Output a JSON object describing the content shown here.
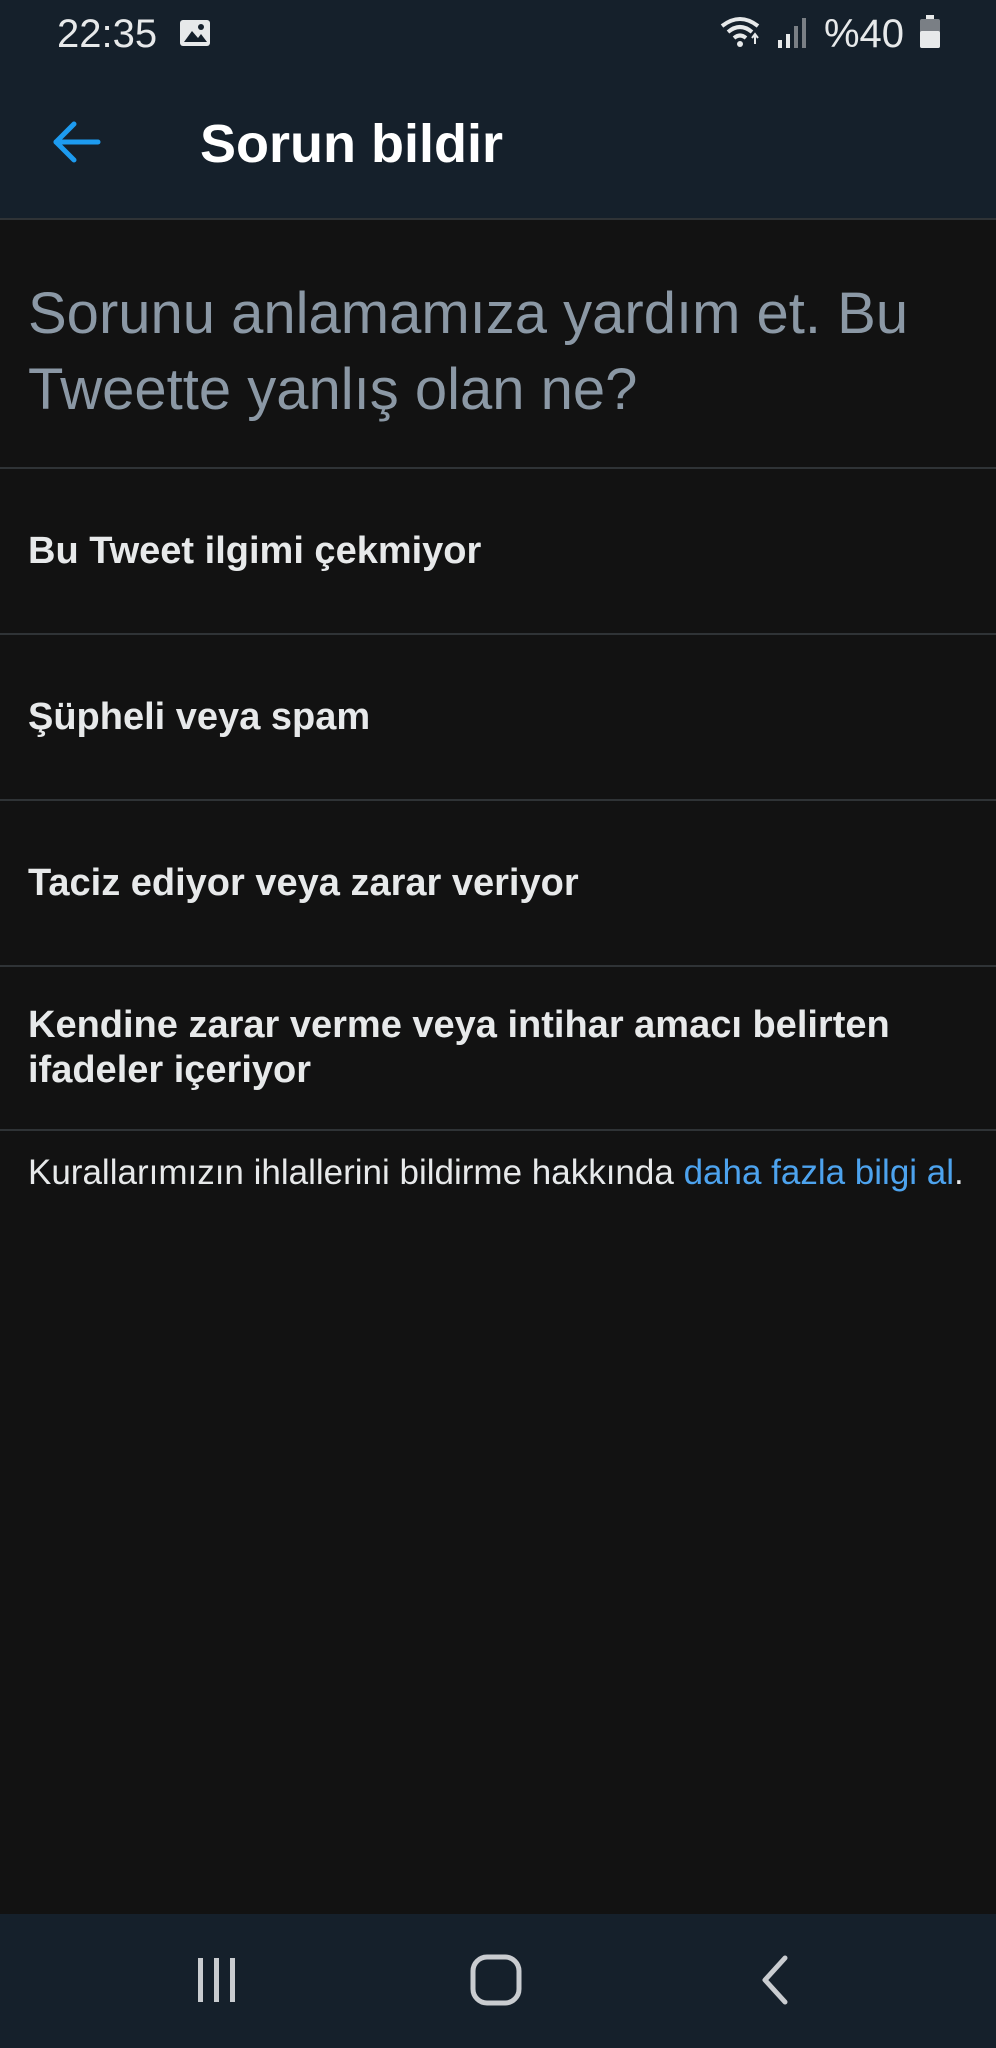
{
  "status_bar": {
    "time": "22:35",
    "battery": "%40",
    "icons": [
      "gallery-icon",
      "wifi-icon",
      "signal-icon",
      "battery-icon"
    ]
  },
  "header": {
    "back_icon": "arrow-left-icon",
    "title": "Sorun bildir"
  },
  "prompt": "Sorunu anlamamıza yardım et. Bu Tweette yanlış olan ne?",
  "options": [
    {
      "label": "Bu Tweet ilgimi çekmiyor"
    },
    {
      "label": "Şüpheli veya spam"
    },
    {
      "label": "Taciz ediyor veya zarar veriyor"
    },
    {
      "label": "Kendine zarar verme veya intihar amacı belirten ifadeler içeriyor"
    }
  ],
  "footer": {
    "text": "Kurallarımızın ihlallerini bildirme hakkında ",
    "link": "daha fazla bilgi al",
    "suffix": "."
  },
  "nav_bar": {
    "icons": [
      "recent-apps-icon",
      "home-icon",
      "back-icon"
    ]
  },
  "colors": {
    "background": "#121212",
    "bar": "#15202b",
    "accent": "#1d9bf0",
    "link": "#4da3ee",
    "divider": "#2f3336"
  }
}
